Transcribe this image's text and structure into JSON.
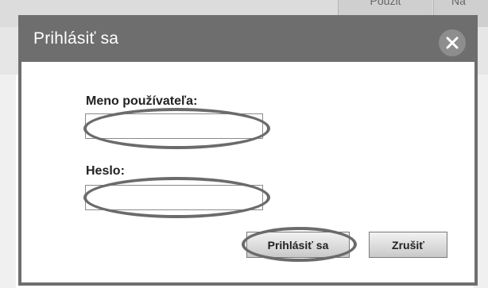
{
  "background": {
    "tabs": [
      {
        "label": "Pouzit"
      },
      {
        "label": "Na"
      }
    ]
  },
  "dialog": {
    "title": "Prihlásiť sa",
    "username_label": "Meno používateľa:",
    "username_value": "",
    "password_label": "Heslo:",
    "password_value": "",
    "login_button": "Prihlásiť sa",
    "cancel_button": "Zrušiť",
    "close_icon": "close-icon"
  },
  "colors": {
    "header": "#6e6e6e",
    "highlight": "#6b6b6b"
  }
}
